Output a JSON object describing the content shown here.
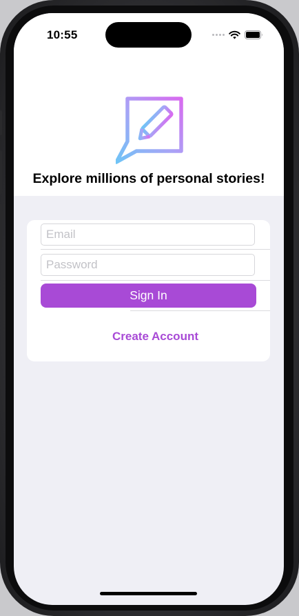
{
  "status_bar": {
    "time": "10:55",
    "icons": [
      "cellular-signal-icon",
      "wifi-icon",
      "battery-icon"
    ]
  },
  "header": {
    "logo_icon": "pencil-speech-bubble-icon",
    "tagline": "Explore millions of personal stories!"
  },
  "login_form": {
    "email_placeholder": "Email",
    "email_value": "",
    "password_placeholder": "Password",
    "password_value": "",
    "sign_in_label": "Sign In",
    "create_account_label": "Create Account"
  },
  "colors": {
    "accent": "#a84ad6",
    "background": "#efeff5",
    "logo_gradient_start": "#6fc4f6",
    "logo_gradient_end": "#d86bf0"
  }
}
